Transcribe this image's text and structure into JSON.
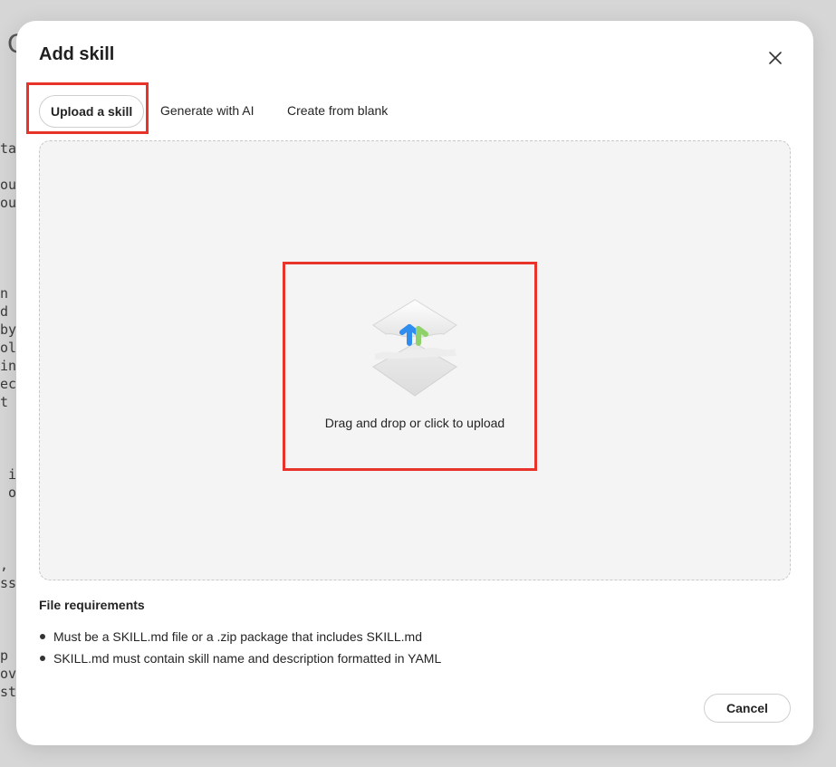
{
  "background": {
    "heading_fragment": "C",
    "text_fragments": [
      "ta",
      "ou",
      "ou",
      "n",
      "d",
      "by",
      "ol",
      "in",
      "ec",
      "t",
      " i",
      " o",
      ",",
      "ss",
      "p",
      "ov",
      "st"
    ]
  },
  "modal": {
    "title": "Add skill",
    "close_icon": "close-icon"
  },
  "tabs": [
    {
      "label": "Upload a skill",
      "active": true
    },
    {
      "label": "Generate with AI",
      "active": false
    },
    {
      "label": "Create from blank",
      "active": false
    }
  ],
  "dropzone": {
    "icon": "upload-icon",
    "text": "Drag and drop or click to upload"
  },
  "requirements": {
    "title": "File requirements",
    "items": [
      "Must be a SKILL.md file or a .zip package that includes SKILL.md",
      "SKILL.md must contain skill name and description formatted in YAML"
    ]
  },
  "footer": {
    "cancel_label": "Cancel"
  },
  "colors": {
    "highlight": "#e8332a",
    "dropzone_bg": "#f4f4f4",
    "arrow_blue": "#2f8df0",
    "arrow_green": "#8fd16a"
  }
}
